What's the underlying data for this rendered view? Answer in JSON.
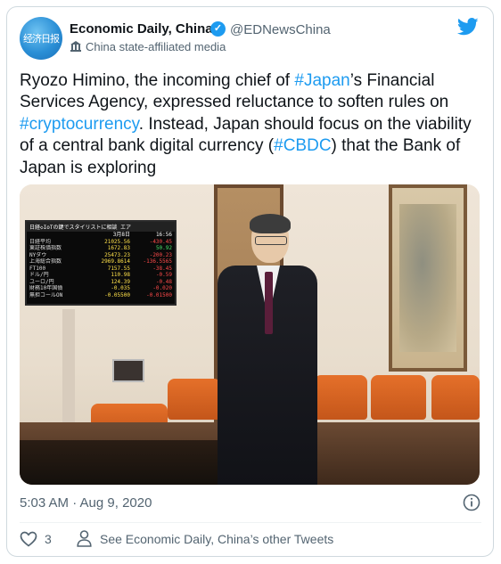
{
  "author": {
    "name": "Economic Daily, China",
    "handle": "@EDNewsChina",
    "affiliation": "China state-affiliated media",
    "avatar_text": "经济日报",
    "verified_icon": "verified-badge-icon"
  },
  "tweet": {
    "text_parts": [
      {
        "t": "Ryozo Himino, the incoming chief of ",
        "tag": false
      },
      {
        "t": "#Japan",
        "tag": true
      },
      {
        "t": "’s Financial Services Agency, expressed reluctance to soften rules on ",
        "tag": false
      },
      {
        "t": "#cryptocurrency",
        "tag": true
      },
      {
        "t": ". Instead, Japan should focus on the viability of a central bank digital currency (",
        "tag": false
      },
      {
        "t": "#CBDC",
        "tag": true
      },
      {
        "t": ") that the Bank of Japan is exploring",
        "tag": false
      }
    ],
    "timestamp": "5:03 AM · Aug 9, 2020",
    "like_count": "3",
    "see_more": "See Economic Daily, China’s other Tweets"
  },
  "media": {
    "ticker_header": "日経◇IoTの鍵でスタイリストに相談  エア",
    "ticker_date": "3月8日",
    "ticker_time": "16:56",
    "ticker_rows": [
      {
        "label": "日経平均",
        "value": "21025.56",
        "change": "-430.45",
        "dir": "down"
      },
      {
        "label": "東証株価指数",
        "value": "1672.83",
        "change": "50.92",
        "dir": "up"
      },
      {
        "label": "NYダウ",
        "value": "25473.23",
        "change": "-200.23",
        "dir": "down"
      },
      {
        "label": "上海総合指数",
        "value": "2969.8614",
        "change": "-136.5565",
        "dir": "down"
      },
      {
        "label": "FT100",
        "value": "7157.55",
        "change": "-38.45",
        "dir": "down"
      },
      {
        "label": "ドル/円",
        "value": "110.98",
        "change": "-0.59",
        "dir": "down"
      },
      {
        "label": "ユーロ/円",
        "value": "124.39",
        "change": "-0.48",
        "dir": "down"
      },
      {
        "label": "財務10年国債",
        "value": "-0.035",
        "change": "-0.020",
        "dir": "down"
      },
      {
        "label": "無担コールON",
        "value": "-0.05500",
        "change": "-0.01500",
        "dir": "down"
      }
    ]
  },
  "colors": {
    "accent": "#1d9bf0",
    "muted": "#536471",
    "border": "#cfd9de"
  }
}
